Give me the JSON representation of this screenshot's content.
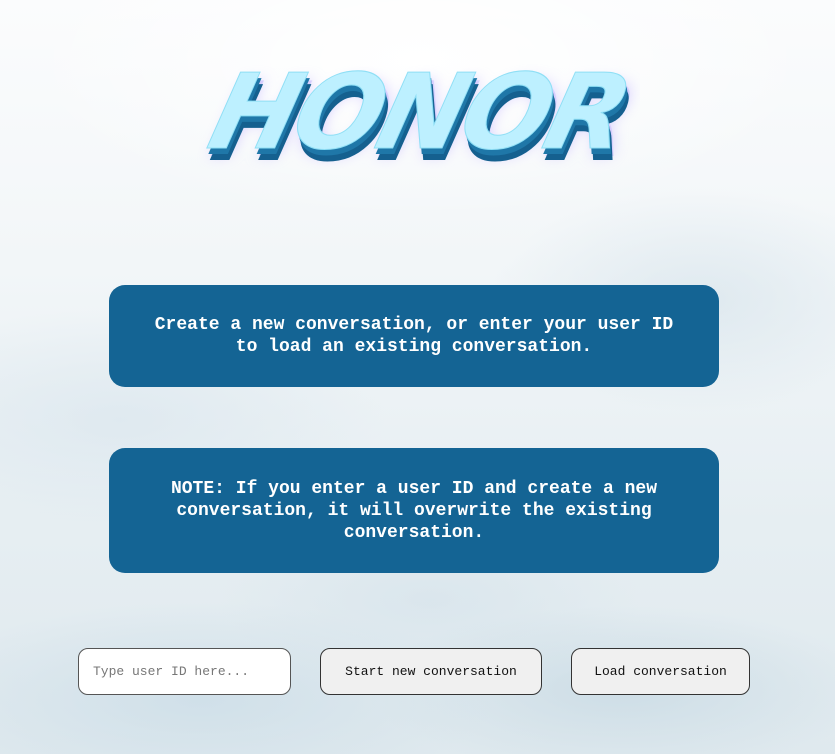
{
  "logo": {
    "text": "HONOR",
    "colors": {
      "face": "#bdf0ff",
      "extrude": "#1a6a9a",
      "glow": "#b9a8ff"
    }
  },
  "messages": {
    "intro": "Create a new conversation, or enter your user ID to load an existing conversation.",
    "note": "NOTE: If you enter a user ID and create a new conversation, it will overwrite the existing conversation."
  },
  "controls": {
    "user_id_value": "",
    "user_id_placeholder": "Type user ID here...",
    "start_label": "Start new conversation",
    "load_label": "Load conversation"
  },
  "colors": {
    "box_background": "#146494",
    "box_text": "#ffffff"
  }
}
